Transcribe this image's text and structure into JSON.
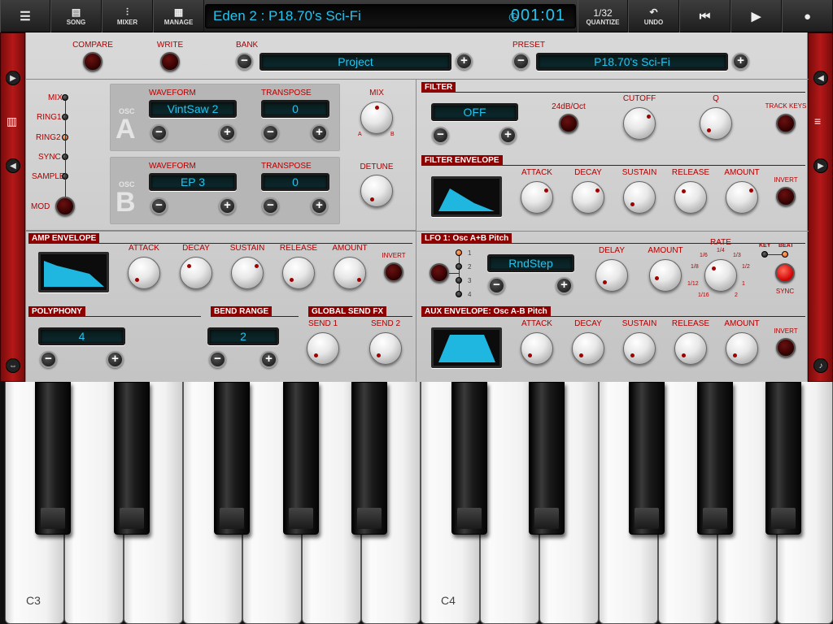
{
  "topbar": {
    "song": "SONG",
    "mixer": "MIXER",
    "manage": "MANAGE",
    "title": "Eden 2 : P18.70's Sci-Fi",
    "position": "001:01",
    "quantize_value": "1/32",
    "quantize": "QUANTIZE",
    "undo": "UNDO"
  },
  "preset_bar": {
    "compare": "COMPARE",
    "write": "WRITE",
    "bank_label": "BANK",
    "bank_value": "Project",
    "preset_label": "PRESET",
    "preset_value": "P18.70's Sci-Fi"
  },
  "osc": {
    "mod_items": [
      "MIX",
      "RING1",
      "RING2",
      "SYNC",
      "SAMPLE"
    ],
    "mod_label": "MOD",
    "a_small": "OSC",
    "a_letter": "A",
    "b_small": "OSC",
    "b_letter": "B",
    "waveform_label": "WAVEFORM",
    "transpose_label": "TRANSPOSE",
    "a_waveform": "VintSaw 2",
    "a_transpose": "0",
    "b_waveform": "EP 3",
    "b_transpose": "0",
    "mix_label": "MIX",
    "mix_a": "A",
    "mix_b": "B",
    "detune_label": "DETUNE"
  },
  "filter": {
    "header": "FILTER",
    "mode_value": "OFF",
    "slope": "24dB/Oct",
    "cutoff": "CUTOFF",
    "q": "Q",
    "track_keys": "TRACK KEYS"
  },
  "filter_env": {
    "header": "FILTER ENVELOPE",
    "attack": "ATTACK",
    "decay": "DECAY",
    "sustain": "SUSTAIN",
    "release": "RELEASE",
    "amount": "AMOUNT",
    "invert": "INVERT"
  },
  "amp_env": {
    "header": "AMP ENVELOPE",
    "attack": "ATTACK",
    "decay": "DECAY",
    "sustain": "SUSTAIN",
    "release": "RELEASE",
    "amount": "AMOUNT",
    "invert": "INVERT"
  },
  "lfo": {
    "header": "LFO 1: Osc A+B Pitch",
    "slots": [
      "1",
      "2",
      "3",
      "4"
    ],
    "wave_value": "RndStep",
    "delay": "DELAY",
    "amount": "AMOUNT",
    "rate": "RATE",
    "rate_ticks": [
      "1/4",
      "1/6",
      "1/3",
      "1/8",
      "1/2",
      "1/12",
      "1",
      "1/16",
      "2"
    ],
    "key": "KEY",
    "beat": "BEAT",
    "sync": "SYNC"
  },
  "polyphony": {
    "header": "POLYPHONY",
    "value": "4"
  },
  "bend_range": {
    "header": "BEND RANGE",
    "value": "2"
  },
  "send_fx": {
    "header": "GLOBAL SEND FX",
    "send1": "SEND 1",
    "send2": "SEND 2"
  },
  "aux_env": {
    "header": "AUX ENVELOPE: Osc A-B Pitch",
    "attack": "ATTACK",
    "decay": "DECAY",
    "sustain": "SUSTAIN",
    "release": "RELEASE",
    "amount": "AMOUNT",
    "invert": "INVERT"
  },
  "keyboard": {
    "c3": "C3",
    "c4": "C4"
  },
  "colors": {
    "lcd_text": "#22c4f0",
    "accent_red": "#8c0000",
    "panel": "#d0d0d0"
  }
}
